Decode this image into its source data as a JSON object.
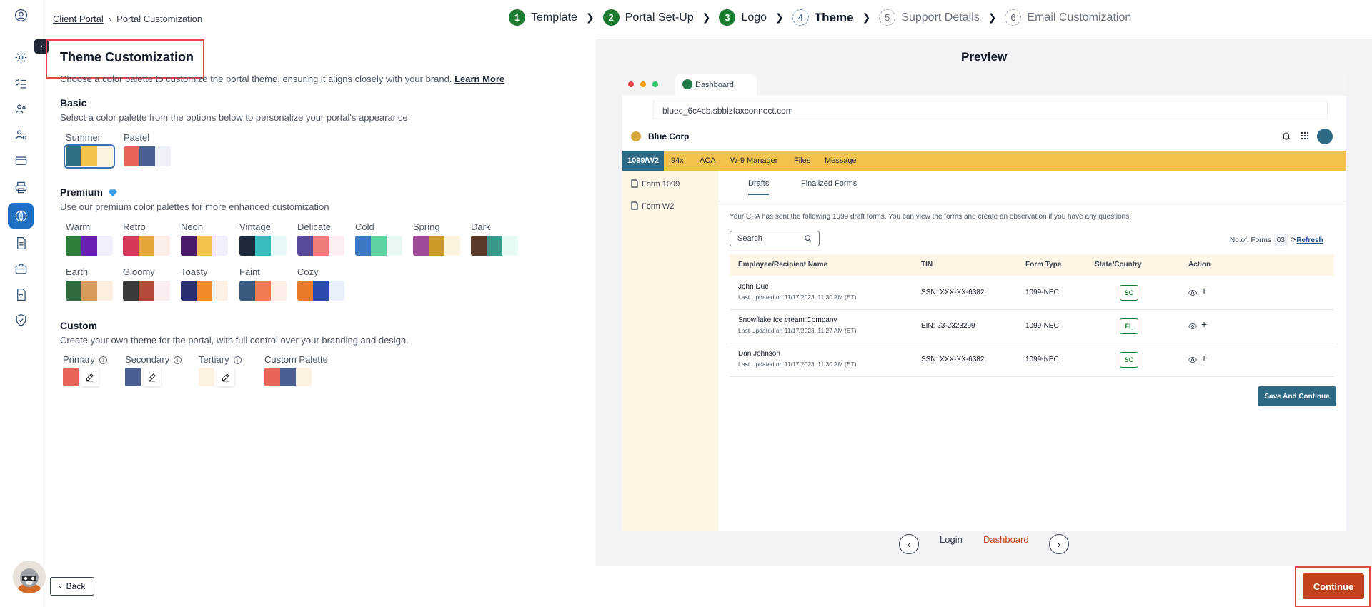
{
  "breadcrumb": {
    "parent": "Client Portal",
    "current": "Portal Customization"
  },
  "steps": [
    {
      "num": "1",
      "label": "Template",
      "state": "done"
    },
    {
      "num": "2",
      "label": "Portal Set-Up",
      "state": "done"
    },
    {
      "num": "3",
      "label": "Logo",
      "state": "done"
    },
    {
      "num": "4",
      "label": "Theme",
      "state": "current"
    },
    {
      "num": "5",
      "label": "Support Details",
      "state": "todo"
    },
    {
      "num": "6",
      "label": "Email Customization",
      "state": "todo"
    }
  ],
  "theme": {
    "title": "Theme Customization",
    "description": "Choose a color palette to customize the portal theme, ensuring it aligns closely with your brand.",
    "learn_more": "Learn More"
  },
  "basic": {
    "heading": "Basic",
    "description": "Select a color palette from the options below to personalize your portal's appearance",
    "palettes": [
      {
        "name": "Summer",
        "colors": [
          "#2f6f86",
          "#f2c34d",
          "#fdf3e0"
        ],
        "selected": true
      },
      {
        "name": "Pastel",
        "colors": [
          "#e8645a",
          "#4c5f93",
          "#eef2f8"
        ],
        "selected": false
      }
    ]
  },
  "premium": {
    "heading": "Premium",
    "description": "Use our premium color palettes for more enhanced customization",
    "palettes": [
      {
        "name": "Warm",
        "colors": [
          "#2e7d3a",
          "#6a1fb0",
          "#eef1fb"
        ]
      },
      {
        "name": "Retro",
        "colors": [
          "#d7375a",
          "#e3a43a",
          "#fbeee6"
        ]
      },
      {
        "name": "Neon",
        "colors": [
          "#4b1a6b",
          "#f1c34a",
          "#f3eefb"
        ]
      },
      {
        "name": "Vintage",
        "colors": [
          "#1e2a3b",
          "#3bbcc0",
          "#e8f7f7"
        ]
      },
      {
        "name": "Delicate",
        "colors": [
          "#5a4a9c",
          "#f07b7b",
          "#fdeff0"
        ]
      },
      {
        "name": "Cold",
        "colors": [
          "#3a78c2",
          "#5fd0a0",
          "#eaf8f3"
        ]
      },
      {
        "name": "Spring",
        "colors": [
          "#a04a9a",
          "#c9992a",
          "#fbf4df"
        ]
      },
      {
        "name": "Dark",
        "colors": [
          "#5a3a2a",
          "#3a9a8a",
          "#e6fbf6"
        ]
      },
      {
        "name": "Earth",
        "colors": [
          "#2f6b3f",
          "#d89a5a",
          "#fcefe2"
        ]
      },
      {
        "name": "Gloomy",
        "colors": [
          "#3a3a3a",
          "#b8483a",
          "#fbeeee"
        ]
      },
      {
        "name": "Toasty",
        "colors": [
          "#2a2e72",
          "#f08a2a",
          "#fdf1e6"
        ]
      },
      {
        "name": "Faint",
        "colors": [
          "#3a5a80",
          "#f07a52",
          "#fdeee8"
        ]
      },
      {
        "name": "Cozy",
        "colors": [
          "#e87a2a",
          "#2a4ab0",
          "#eaf0fb"
        ]
      }
    ]
  },
  "custom": {
    "heading": "Custom",
    "description": "Create your own theme for the portal, with full control over your branding and design.",
    "primary_label": "Primary",
    "secondary_label": "Secondary",
    "tertiary_label": "Tertiary",
    "palette_label": "Custom Palette",
    "primary_color": "#e8645a",
    "secondary_color": "#4c5f93",
    "tertiary_color": "#fdf3e0"
  },
  "preview": {
    "title": "Preview",
    "browser_tab": "Dashboard",
    "address": "bluec_6c4cb.sbbiztaxconnect.com",
    "company": "Blue Corp",
    "nav_tabs": [
      "1099/W2",
      "94x",
      "ACA",
      "W-9 Manager",
      "Files",
      "Message"
    ],
    "side_items": [
      "Form 1099",
      "Form W2"
    ],
    "content_tabs": [
      "Drafts",
      "Finalized Forms"
    ],
    "message": "Your CPA has sent the following 1099 draft forms. You can view the forms and create an observation if you have any questions.",
    "search_placeholder": "Search",
    "forms_count_label": "No.of. Forms",
    "forms_count": "03",
    "refresh_label": "Refresh",
    "columns": [
      "Employee/Recipient Name",
      "TIN",
      "Form Type",
      "State/Country",
      "Action"
    ],
    "rows": [
      {
        "name": "John Due",
        "updated": "Last Updated on 11/17/2023, 11:30 AM (ET)",
        "tin": "SSN: XXX-XX-6382",
        "form": "1099-NEC",
        "state": "SC"
      },
      {
        "name": "Snowflake Ice cream Company",
        "updated": "Last Updated on 11/17/2023, 11:27 AM (ET)",
        "tin": "EIN: 23-2323299",
        "form": "1099-NEC",
        "state": "FL"
      },
      {
        "name": "Dan Johnson",
        "updated": "Last Updated on 11/17/2023, 11:30 AM (ET)",
        "tin": "SSN: XXX-XX-6382",
        "form": "1099-NEC",
        "state": "SC"
      }
    ],
    "save_button": "Save And Continue",
    "pager": {
      "login": "Login",
      "dashboard": "Dashboard"
    }
  },
  "footer": {
    "back": "Back",
    "continue": "Continue"
  }
}
